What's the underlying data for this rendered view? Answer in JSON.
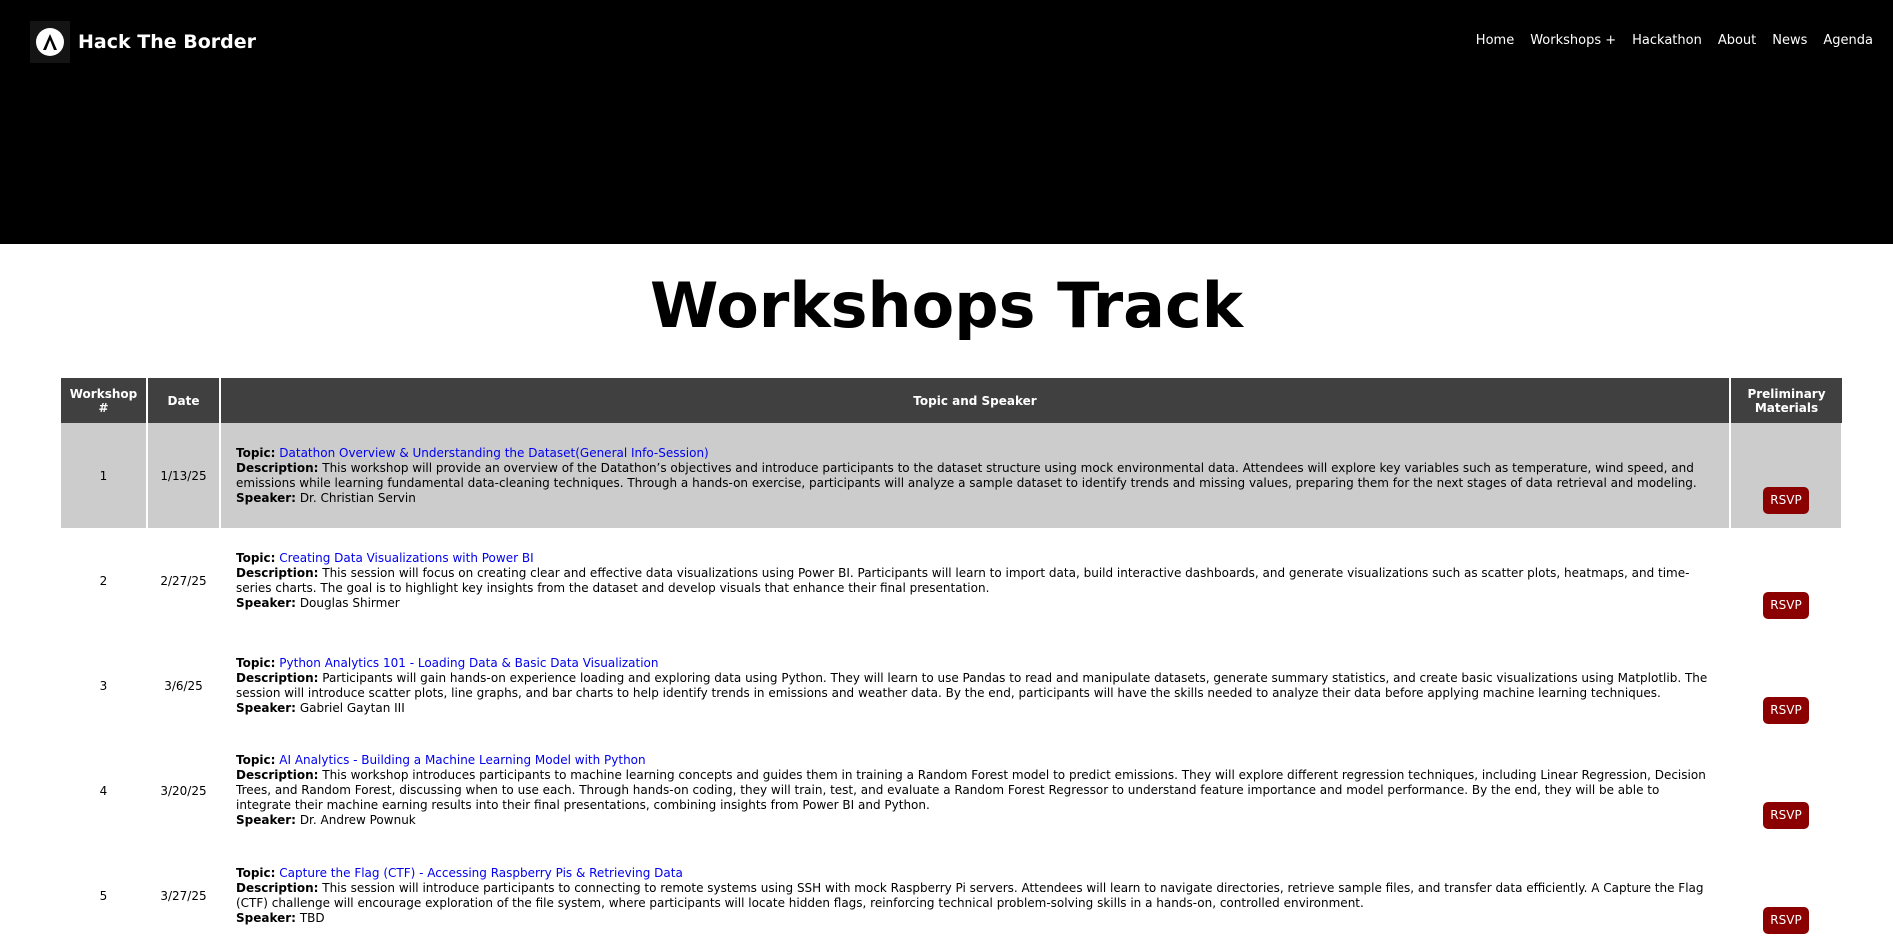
{
  "header": {
    "brand_name": "Hack The Border",
    "logo_icon": "mountain-a-logo-icon",
    "nav": [
      "Home",
      "Workshops +",
      "Hackathon",
      "About",
      "News",
      "Agenda"
    ]
  },
  "main": {
    "title": "Workshops Track",
    "table": {
      "columns": [
        "Workshop #",
        "Date",
        "Topic and Speaker",
        "Preliminary Materials"
      ],
      "labels": {
        "topic": "Topic:",
        "description": "Description:",
        "speaker": "Speaker:"
      },
      "rows": [
        {
          "num": "1",
          "date": "1/13/25",
          "topic": "Datathon Overview & Understanding the Dataset(General Info-Session)",
          "description": "This workshop will provide an overview of the Datathon’s objectives and introduce participants to the dataset structure using mock environmental data. Attendees will explore key variables such as temperature, wind speed, and emissions while learning fundamental data-cleaning techniques. Through a hands-on exercise, participants will analyze a sample dataset to identify trends and missing values, preparing them for the next stages of data retrieval and modeling.",
          "speaker": "Dr. Christian Servin",
          "button": "RSVP"
        },
        {
          "num": "2",
          "date": "2/27/25",
          "topic": "Creating Data Visualizations with Power BI",
          "description": "This session will focus on creating clear and effective data visualizations using Power BI. Participants will learn to import data, build interactive dashboards, and generate visualizations such as scatter plots, heatmaps, and time-series charts. The goal is to highlight key insights from the dataset and develop visuals that enhance their final presentation.",
          "speaker": "Douglas Shirmer",
          "button": "RSVP"
        },
        {
          "num": "3",
          "date": "3/6/25",
          "topic": "Python Analytics 101 - Loading Data & Basic Data Visualization",
          "description": "Participants will gain hands-on experience loading and exploring data using Python. They will learn to use Pandas to read and manipulate datasets, generate summary statistics, and create basic visualizations using Matplotlib. The session will introduce scatter plots, line graphs, and bar charts to help identify trends in emissions and weather data. By the end, participants will have the skills needed to analyze their data before applying machine learning techniques.",
          "speaker": "Gabriel Gaytan III",
          "button": "RSVP"
        },
        {
          "num": "4",
          "date": "3/20/25",
          "topic": "AI Analytics - Building a Machine Learning Model with Python",
          "description": "This workshop introduces participants to machine learning concepts and guides them in training a Random Forest model to predict emissions. They will explore different regression techniques, including Linear Regression, Decision Trees, and Random Forest, discussing when to use each. Through hands-on coding, they will train, test, and evaluate a Random Forest Regressor to understand feature importance and model performance. By the end, they will be able to integrate their machine earning results into their final presentations, combining insights from Power BI and Python.",
          "speaker": "Dr. Andrew Pownuk",
          "button": "RSVP"
        },
        {
          "num": "5",
          "date": "3/27/25",
          "topic": "Capture the Flag (CTF) - Accessing Raspberry Pis & Retrieving Data",
          "description": "This session will introduce participants to connecting to remote systems using SSH with mock Raspberry Pi servers. Attendees will learn to navigate directories, retrieve sample files, and transfer data efficiently. A Capture the Flag (CTF) challenge will encourage exploration of the file system, where participants will locate hidden flags, reinforcing technical problem-solving skills in a hands-on, controlled environment.",
          "speaker": "TBD",
          "button": "RSVP"
        }
      ]
    }
  },
  "colors": {
    "header_bg": "#000000",
    "table_header_bg": "#404040",
    "highlight_row_bg": "#cccccc",
    "link": "#0000ee",
    "rsvp_bg": "#8b0000"
  }
}
